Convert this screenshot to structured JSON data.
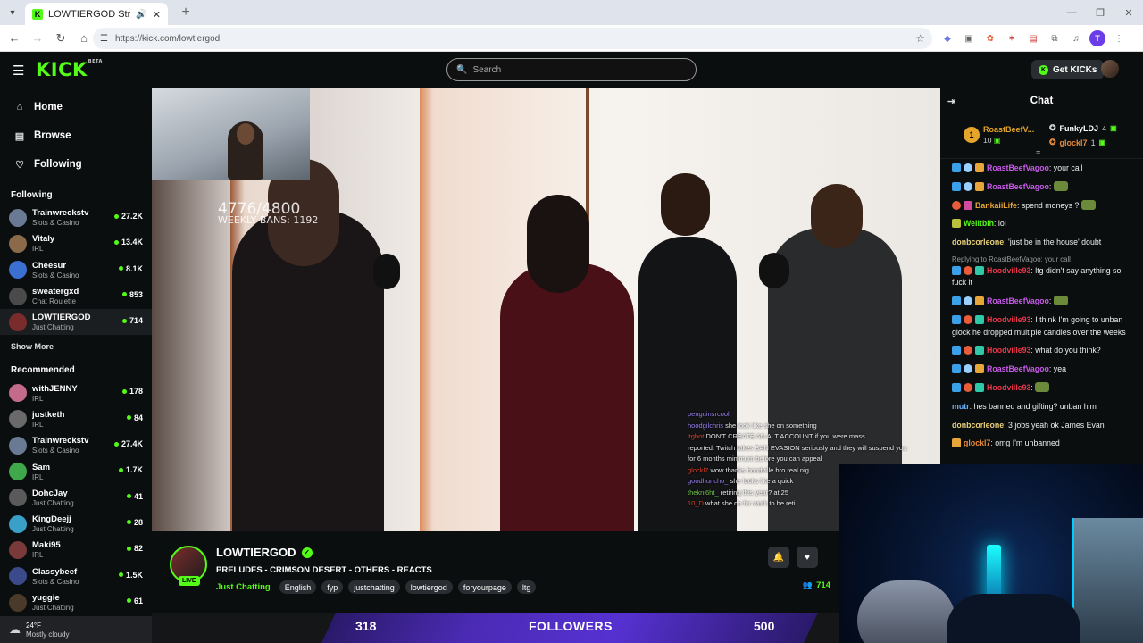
{
  "browser": {
    "tab_title": "LOWTIERGOD Stream - Watch",
    "url": "https://kick.com/lowtiergod",
    "profile_initial": "T"
  },
  "header": {
    "logo": "KICK",
    "logo_badge": "BETA",
    "search_placeholder": "Search",
    "get_kicks": "Get KICKs"
  },
  "nav": [
    {
      "label": "Home",
      "icon": "home-icon"
    },
    {
      "label": "Browse",
      "icon": "browse-icon"
    },
    {
      "label": "Following",
      "icon": "heart-icon"
    }
  ],
  "following_heading": "Following",
  "following": [
    {
      "name": "Trainwreckstv",
      "category": "Slots & Casino",
      "viewers": "27.2K",
      "color": "#6b7a94"
    },
    {
      "name": "Vitaly",
      "category": "IRL",
      "viewers": "13.4K",
      "color": "#8a6a4a"
    },
    {
      "name": "Cheesur",
      "category": "Slots & Casino",
      "viewers": "8.1K",
      "color": "#3b6fd1"
    },
    {
      "name": "sweatergxd",
      "category": "Chat Roulette",
      "viewers": "853",
      "color": "#4a4a4a"
    },
    {
      "name": "LOWTIERGOD",
      "category": "Just Chatting",
      "viewers": "714",
      "color": "#7a2b2b"
    }
  ],
  "show_more": "Show More",
  "recommended_heading": "Recommended",
  "recommended": [
    {
      "name": "withJENNY",
      "category": "IRL",
      "viewers": "178",
      "color": "#c46a8a"
    },
    {
      "name": "justketh",
      "category": "IRL",
      "viewers": "84",
      "color": "#6a6a6a"
    },
    {
      "name": "Trainwreckstv",
      "category": "Slots & Casino",
      "viewers": "27.4K",
      "color": "#6b7a94"
    },
    {
      "name": "Sam",
      "category": "IRL",
      "viewers": "1.7K",
      "color": "#3ea84a"
    },
    {
      "name": "DohcJay",
      "category": "Just Chatting",
      "viewers": "41",
      "color": "#5a5a5a"
    },
    {
      "name": "KingDeejj",
      "category": "Just Chatting",
      "viewers": "28",
      "color": "#3aa0c8"
    },
    {
      "name": "Maki95",
      "category": "IRL",
      "viewers": "82",
      "color": "#7a3a3a"
    },
    {
      "name": "Classybeef",
      "category": "Slots & Casino",
      "viewers": "1.5K",
      "color": "#3a4a8a"
    },
    {
      "name": "yuggie",
      "category": "Just Chatting",
      "viewers": "61",
      "color": "#4a3a2a"
    }
  ],
  "video": {
    "counter": "4776/4800",
    "bans": "WEEKLY BANS: 1192",
    "overlay_chat": [
      {
        "user": "penguinsrcool",
        "text": "",
        "cls": "u1"
      },
      {
        "user": "hoodgilchris",
        "text": "she look like she on something",
        "cls": "u1"
      },
      {
        "user": "ltgbot",
        "text": "DON'T CREATE AN ALT ACCOUNT if you were mass",
        "cls": "u2"
      },
      {
        "user": "",
        "text": "reported. Twitch takes BAN EVASION seriously and they will suspend you",
        "cls": ""
      },
      {
        "user": "",
        "text": "for 6 months minimum before you can appeal",
        "cls": ""
      },
      {
        "user": "glockl7",
        "text": "wow thanks hoodville bro real nig",
        "cls": "u2"
      },
      {
        "user": "goodhuncho_",
        "text": "she looks like a quick",
        "cls": "u1"
      },
      {
        "user": "thekni6ht_",
        "text": "retiring this year? at 25",
        "cls": "u3"
      },
      {
        "user": "10_D",
        "text": "what she do for work to be reti",
        "cls": "u2"
      }
    ]
  },
  "channel": {
    "name": "LOWTIERGOD",
    "live": "LIVE",
    "title": "PRELUDES - CRIMSON DESERT - OTHERS - REACTS",
    "category": "Just Chatting",
    "tags": [
      "English",
      "fyp",
      "justchatting",
      "lowtiergod",
      "foryourpage",
      "ltg"
    ],
    "viewers": "714"
  },
  "chat": {
    "title": "Chat",
    "leaderboard": {
      "first_name": "RoastBeefV...",
      "first_value": "10",
      "first_rank": "1",
      "second_name": "FunkyLDJ",
      "second_value": "4",
      "third_name": "glockl7",
      "third_value": "1"
    },
    "messages": [
      {
        "badges": [
          "b-blue",
          "b-dia",
          "b-gift"
        ],
        "user": "RoastBeefVagoo",
        "color": "#c75ae8",
        "text": ": your call"
      },
      {
        "badges": [
          "b-blue",
          "b-dia",
          "b-gift"
        ],
        "user": "RoastBeefVagoo",
        "color": "#c75ae8",
        "text": ": "
      },
      {
        "badges": [
          "b-red",
          "b-pink"
        ],
        "user": "BankaiiLife",
        "color": "#e8a63a",
        "text": ": spend moneys ?"
      },
      {
        "badges": [
          "b-gold"
        ],
        "user": "Welitbih",
        "color": "#53fc18",
        "text": ": lol"
      },
      {
        "badges": [],
        "user": "donbcorleone",
        "color": "#e8d07a",
        "text": ": 'just be in the house' doubt"
      },
      {
        "reply": "Replying to RoastBeefVagoo: your call",
        "badges": [
          "b-blue",
          "b-red",
          "b-mod"
        ],
        "user": "Hoodville93",
        "color": "#e8364a",
        "text": ": ltg didn't say anything so fuck it"
      },
      {
        "badges": [
          "b-blue",
          "b-dia",
          "b-gift"
        ],
        "user": "RoastBeefVagoo",
        "color": "#c75ae8",
        "text": ": "
      },
      {
        "badges": [
          "b-blue",
          "b-red",
          "b-mod"
        ],
        "user": "Hoodville93",
        "color": "#e8364a",
        "text": ": I think I'm going to unban glock he dropped multiple candies over the weeks"
      },
      {
        "badges": [
          "b-blue",
          "b-red",
          "b-mod"
        ],
        "user": "Hoodville93",
        "color": "#e8364a",
        "text": ": what do you think?"
      },
      {
        "badges": [
          "b-blue",
          "b-dia",
          "b-gift"
        ],
        "user": "RoastBeefVagoo",
        "color": "#c75ae8",
        "text": ": yea"
      },
      {
        "badges": [
          "b-blue",
          "b-red",
          "b-mod"
        ],
        "user": "Hoodville93",
        "color": "#e8364a",
        "text": ": "
      },
      {
        "badges": [],
        "user": "mutr",
        "color": "#6ab0ff",
        "text": ": hes banned and gifting? unban him"
      },
      {
        "badges": [],
        "user": "donbcorleone",
        "color": "#e8d07a",
        "text": ": 3 jobs yeah ok James Evan"
      },
      {
        "badges": [
          "b-gift"
        ],
        "user": "glockl7",
        "color": "#e78a3b",
        "text": ": omg I'm unbanned"
      }
    ]
  },
  "banner": {
    "count_left": "318",
    "label": "FOLLOWERS",
    "count_right": "500"
  },
  "taskbar": {
    "temp": "24°F",
    "condition": "Mostly cloudy"
  }
}
